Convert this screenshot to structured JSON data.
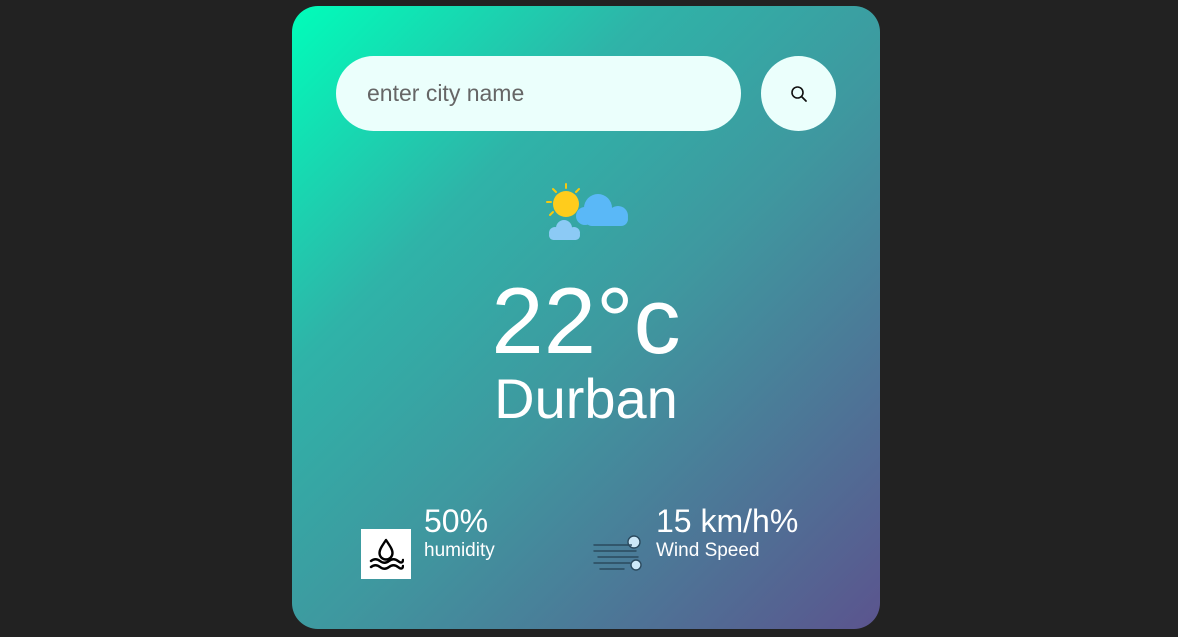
{
  "search": {
    "placeholder": "enter city name",
    "value": "",
    "icon": "search-icon"
  },
  "weather": {
    "icon": "partly-cloudy-icon",
    "temperature": "22°c",
    "city": "Durban"
  },
  "details": {
    "humidity": {
      "icon": "humidity-icon",
      "value": "50%",
      "label": "humidity"
    },
    "wind": {
      "icon": "wind-icon",
      "value": "15 km/h%",
      "label": "Wind Speed"
    }
  },
  "colors": {
    "background": "#222222",
    "gradient_start": "#00feba",
    "gradient_end": "#5b548e",
    "input_bg": "#ebfffc",
    "text": "#ffffff"
  }
}
